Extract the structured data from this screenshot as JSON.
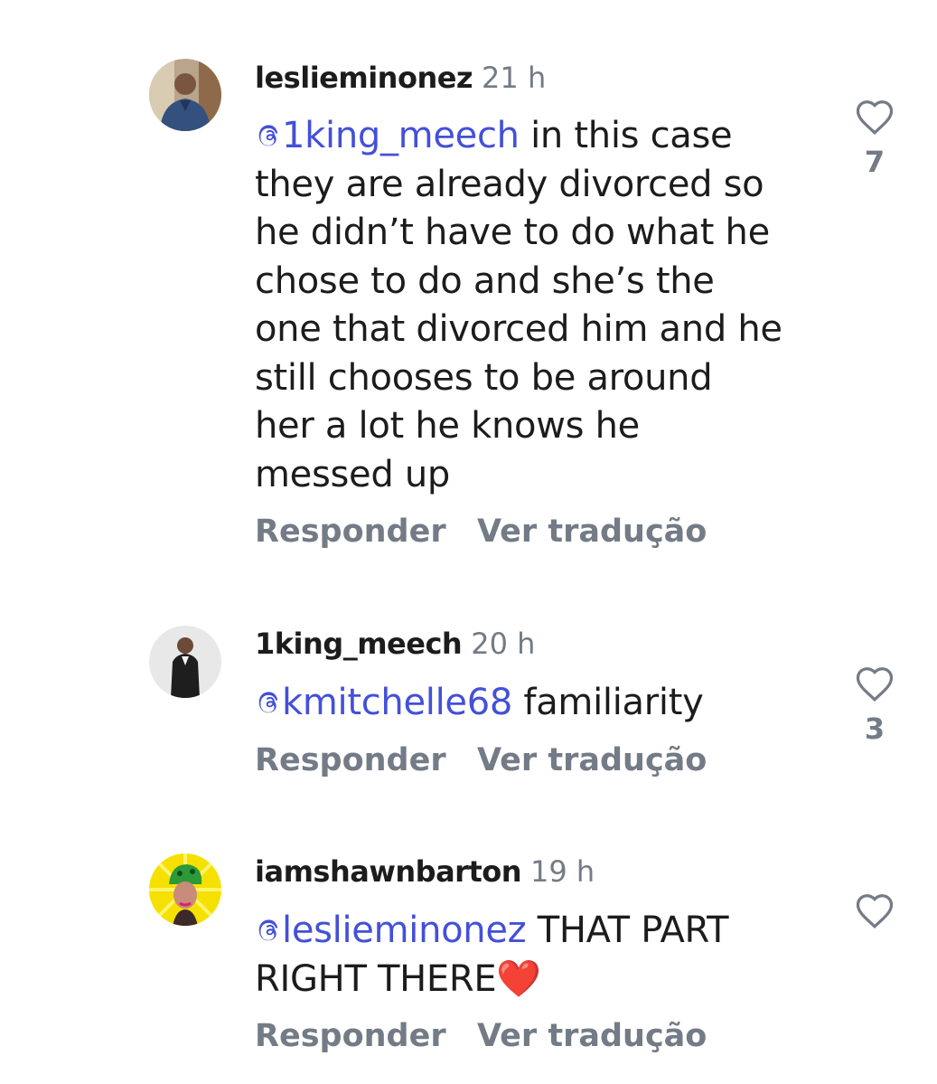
{
  "comments": [
    {
      "username": "leslieminonez",
      "time": "21 h",
      "mention": "1king_meech",
      "lines": [
        " in this case",
        "they are already divorced so",
        "he didn’t have to do what he",
        "chose to do and she’s the",
        "one that divorced him and he",
        "still chooses to be around",
        "her a lot he knows he",
        "messed up"
      ],
      "reply_label": "Responder",
      "translate_label": "Ver tradução",
      "likes": "7",
      "avatar": "avatar-man-blue-shirt"
    },
    {
      "username": "1king_meech",
      "time": "20 h",
      "mention": "kmitchelle68",
      "lines": [
        " familiarity"
      ],
      "reply_label": "Responder",
      "translate_label": "Ver tradução",
      "likes": "3",
      "avatar": "avatar-man-leather-jacket"
    },
    {
      "username": "iamshawnbarton",
      "time": "19 h",
      "mention": "leslieminonez",
      "lines": [
        " THAT PART",
        "RIGHT THERE❤️"
      ],
      "reply_label": "Responder",
      "translate_label": "Ver tradução",
      "likes": "",
      "avatar": "avatar-woman-green-headwrap"
    }
  ],
  "colors": {
    "mention": "#4350d8",
    "muted": "#737b86",
    "text": "#1c1c1c"
  },
  "icons": [
    "threads-at-icon",
    "heart-outline-icon"
  ]
}
